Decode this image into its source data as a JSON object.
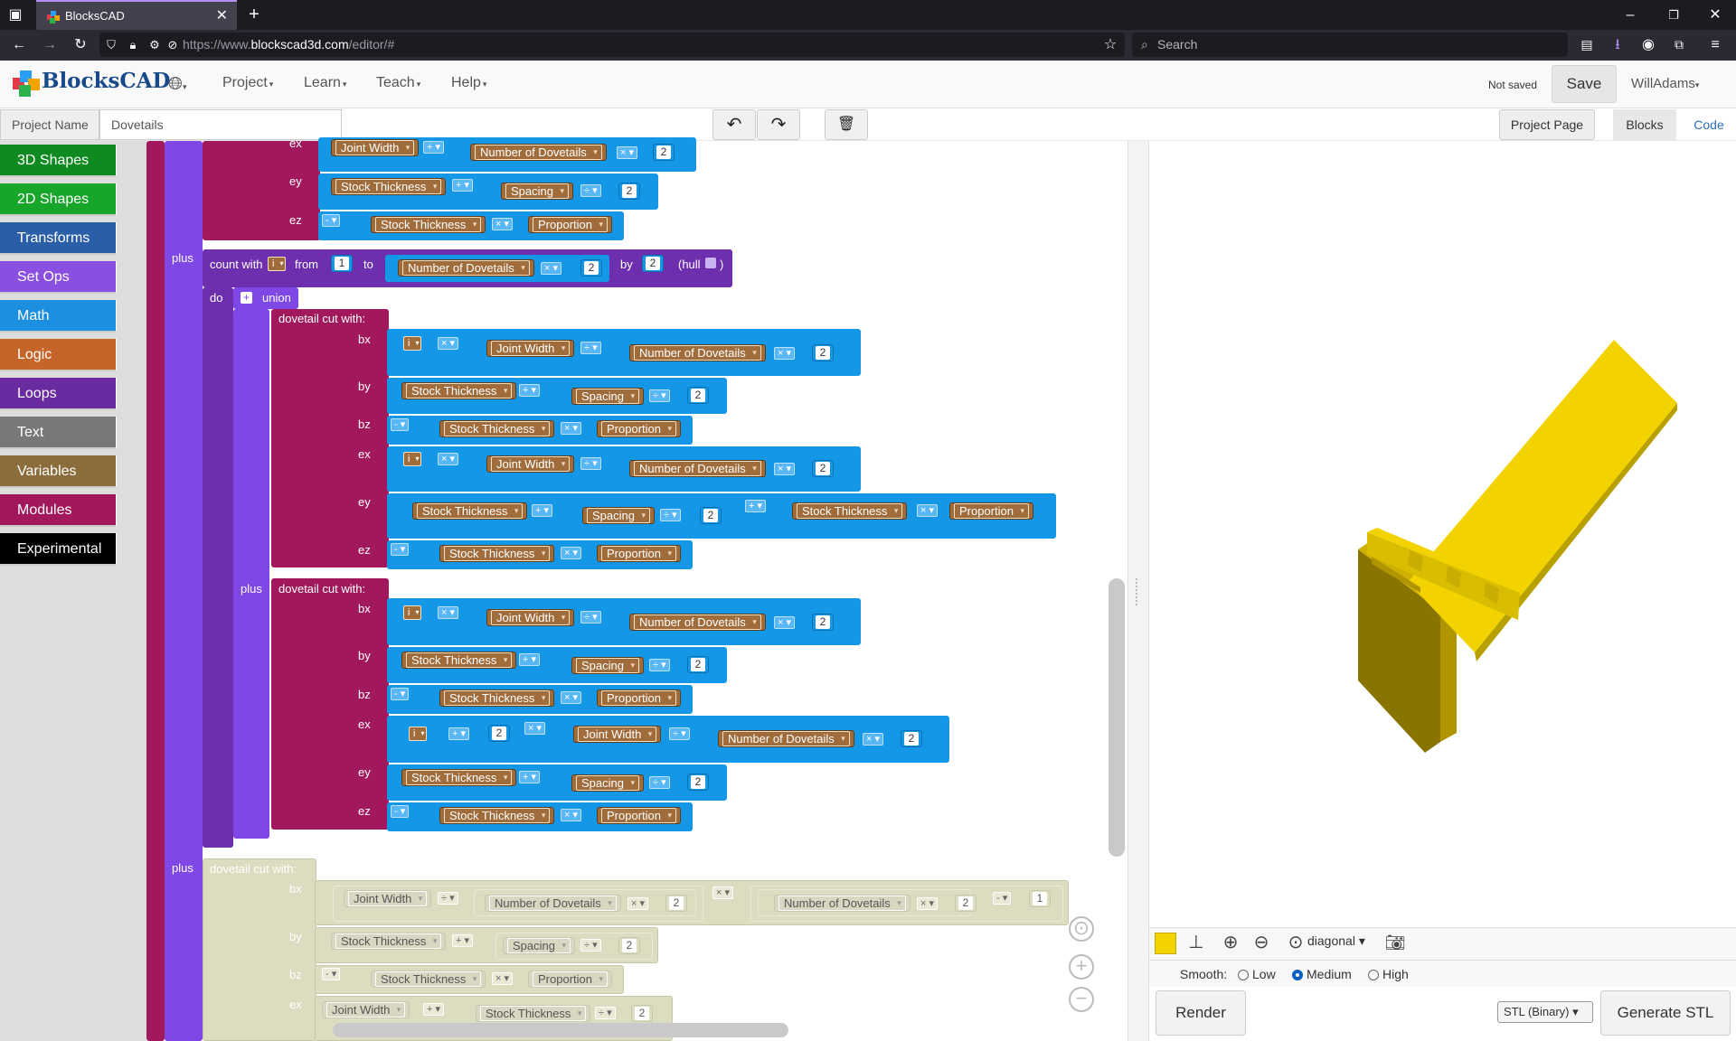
{
  "browser": {
    "tab_title": "BlocksCAD",
    "url_prefix": "https://www.",
    "url_domain": "blockscad3d.com",
    "url_path": "/editor/#",
    "search_placeholder": "Search"
  },
  "header": {
    "logo_text": "BlocksCAD",
    "menus": [
      "Project",
      "Learn",
      "Teach",
      "Help"
    ],
    "status": "Not saved",
    "save_label": "Save",
    "user": "WillAdams"
  },
  "project": {
    "name_label": "Project Name",
    "name_value": "Dovetails",
    "page_button": "Project Page",
    "tabs": [
      "Blocks",
      "Code"
    ]
  },
  "toolbox": {
    "categories": [
      {
        "label": "3D Shapes",
        "color": "#0f8a20"
      },
      {
        "label": "2D Shapes",
        "color": "#17a52a"
      },
      {
        "label": "Transforms",
        "color": "#2a5fa8"
      },
      {
        "label": "Set Ops",
        "color": "#8a4fe0"
      },
      {
        "label": "Math",
        "color": "#1c8fe0"
      },
      {
        "label": "Logic",
        "color": "#c6652a"
      },
      {
        "label": "Loops",
        "color": "#6a2aa0"
      },
      {
        "label": "Text",
        "color": "#787878"
      },
      {
        "label": "Variables",
        "color": "#8a6d3b"
      },
      {
        "label": "Modules",
        "color": "#a1195c"
      },
      {
        "label": "Experimental",
        "color": "#000000"
      }
    ]
  },
  "blocks": {
    "kw": {
      "ex": "ex",
      "ey": "ey",
      "ez": "ez",
      "bx": "bx",
      "by": "by",
      "bz": "bz",
      "plus": "plus",
      "do": "do",
      "union": "union",
      "from": "from",
      "to": "to",
      "by_kw": "by",
      "count_with": "count with",
      "hull": "(hull",
      "close_paren": ")",
      "dovetail": "dovetail cut  with:"
    },
    "vars": {
      "joint_width": "Joint Width",
      "num_dovetails": "Number of Dovetails",
      "stock_thickness": "Stock Thickness",
      "spacing": "Spacing",
      "proportion": "Proportion",
      "i": "i"
    },
    "ops": {
      "plus": "+",
      "minus": "-",
      "times": "×",
      "div": "÷"
    },
    "nums": {
      "one": "1",
      "two": "2"
    }
  },
  "render": {
    "color": "#f2d300",
    "view": "diagonal",
    "smooth_label": "Smooth:",
    "smooth_options": [
      "Low",
      "Medium",
      "High"
    ],
    "smooth_selected": "Medium",
    "render_button": "Render",
    "format": "STL (Binary)",
    "generate_button": "Generate STL"
  }
}
